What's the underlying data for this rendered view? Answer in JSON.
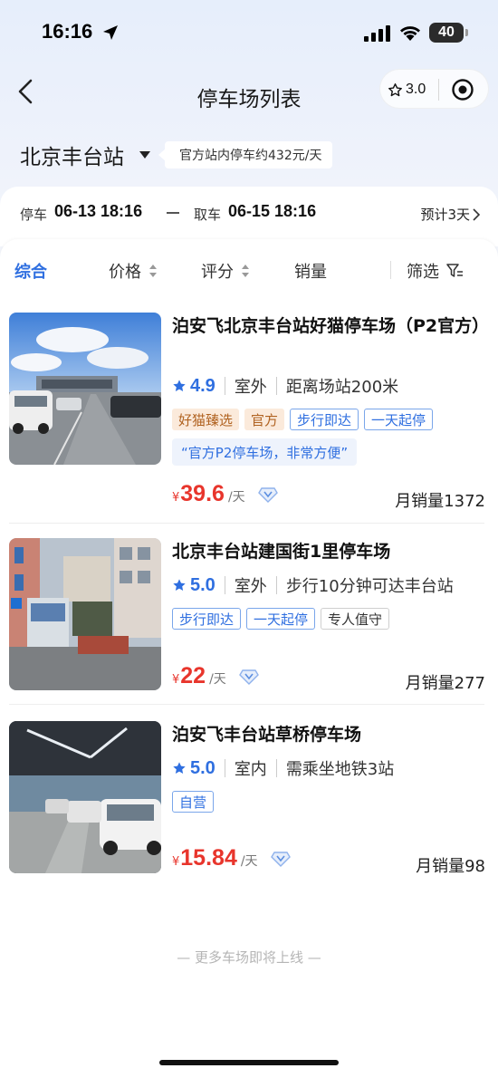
{
  "status_bar": {
    "time": "16:16",
    "battery": "40"
  },
  "nav": {
    "title": "停车场列表",
    "capsule_score": "3.0"
  },
  "station": {
    "name": "北京丰台站",
    "notice": "官方站内停车约432元/天"
  },
  "time_info": {
    "park_label": "停车",
    "park_time": "06-13 18:16",
    "pick_label": "取车",
    "pick_time": "06-15 18:16",
    "estimate": "预计3天"
  },
  "sort": {
    "comprehensive": "综合",
    "price": "价格",
    "rating": "评分",
    "sales": "销量",
    "filter": "筛选"
  },
  "lots": [
    {
      "title": "泊安飞北京丰台站好猫停车场（P2官方）",
      "rating": "4.9",
      "type": "室外",
      "distance": "距离场站200米",
      "tags": [
        {
          "text": "好猫臻选",
          "style": "orange"
        },
        {
          "text": "官方",
          "style": "orange"
        },
        {
          "text": "步行即达",
          "style": "blue"
        },
        {
          "text": "一天起停",
          "style": "blue"
        }
      ],
      "quote": "“官方P2停车场，非常方便”",
      "price_symbol": "¥",
      "price": "39.6",
      "unit": "/天",
      "sales": "月销量1372"
    },
    {
      "title": "北京丰台站建国街1里停车场",
      "rating": "5.0",
      "type": "室外",
      "distance": "步行10分钟可达丰台站",
      "tags": [
        {
          "text": "步行即达",
          "style": "blue"
        },
        {
          "text": "一天起停",
          "style": "blue"
        },
        {
          "text": "专人值守",
          "style": "gray"
        }
      ],
      "quote": "",
      "price_symbol": "¥",
      "price": "22",
      "unit": "/天",
      "sales": "月销量277"
    },
    {
      "title": "泊安飞丰台站草桥停车场",
      "rating": "5.0",
      "type": "室内",
      "distance": "需乘坐地铁3站",
      "tags": [
        {
          "text": "自营",
          "style": "blue"
        }
      ],
      "quote": "",
      "price_symbol": "¥",
      "price": "15.84",
      "unit": "/天",
      "sales": "月销量98"
    }
  ],
  "footer": {
    "note": "— 更多车场即将上线 —"
  },
  "colors": {
    "accent": "#2f6fe0",
    "price": "#e8352c",
    "tag_orange_bg": "#fbeadb"
  }
}
